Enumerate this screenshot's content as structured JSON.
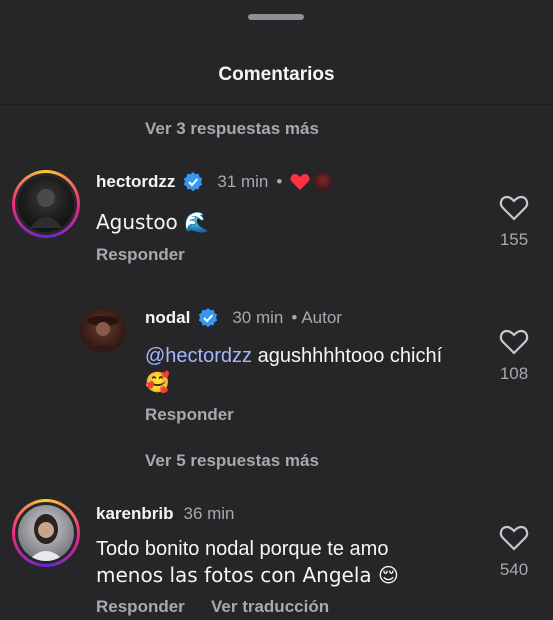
{
  "header": {
    "title": "Comentarios"
  },
  "top_thread": {
    "view_replies": "Ver 3 respuestas más"
  },
  "comments": [
    {
      "username": "hectordzz",
      "time": "31 min",
      "separator": "•",
      "text": "Agustoo 🌊",
      "reply_label": "Responder",
      "likes": "155"
    },
    {
      "username": "nodal",
      "time": "30 min",
      "separator": "•",
      "role": "Autor",
      "mention": "@hectordzz",
      "text": " agushhhhtooo chichí",
      "text_line2": "🥰",
      "reply_label": "Responder",
      "likes": "108"
    },
    {
      "username": "karenbrib",
      "time": "36 min",
      "text_line1": "Todo bonito nodal porque te amo",
      "text_line2": "menos las fotos con Angela 😌",
      "reply_label": "Responder",
      "translate_label": "Ver traducción",
      "likes": "540"
    }
  ],
  "nodal_thread": {
    "view_replies": "Ver 5 respuestas más"
  },
  "colors": {
    "background": "#262629",
    "verified": "#3897f0",
    "heart_red": "#ff3040",
    "mention": "#a4b7ff"
  }
}
